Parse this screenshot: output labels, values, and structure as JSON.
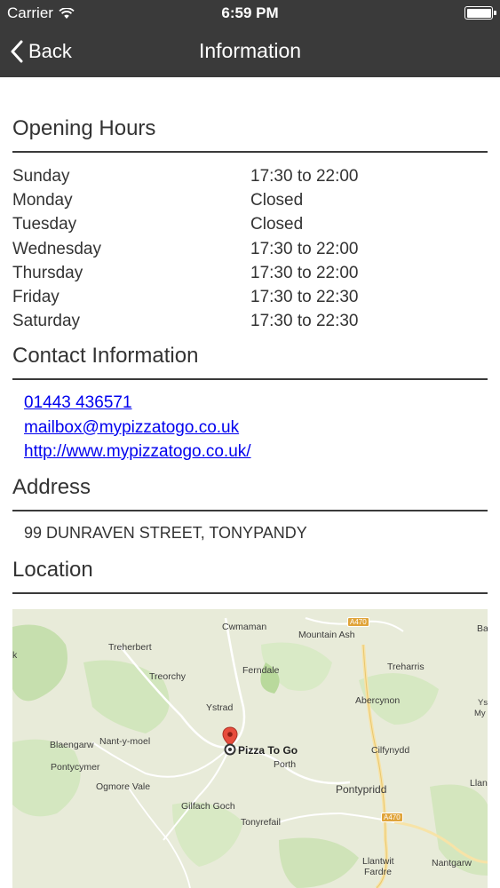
{
  "status_bar": {
    "carrier": "Carrier",
    "time": "6:59 PM",
    "battery_level": 1.0
  },
  "nav": {
    "back_label": "Back",
    "title": "Information"
  },
  "opening_hours": {
    "title": "Opening Hours",
    "rows": [
      {
        "day": "Sunday",
        "hours": "17:30 to 22:00"
      },
      {
        "day": "Monday",
        "hours": "Closed"
      },
      {
        "day": "Tuesday",
        "hours": "Closed"
      },
      {
        "day": "Wednesday",
        "hours": "17:30 to 22:00"
      },
      {
        "day": "Thursday",
        "hours": "17:30 to 22:00"
      },
      {
        "day": "Friday",
        "hours": "17:30 to 22:30"
      },
      {
        "day": "Saturday",
        "hours": "17:30 to 22:30"
      }
    ]
  },
  "contact": {
    "title": "Contact Information",
    "phone": "01443 436571",
    "email": "mailbox@mypizzatogo.co.uk",
    "website": "http://www.mypizzatogo.co.uk/"
  },
  "address": {
    "title": "Address",
    "value": "99 DUNRAVEN STREET, TONYPANDY"
  },
  "location": {
    "title": "Location",
    "pin_label": "Pizza To Go",
    "places": {
      "cwmaman": "Cwmaman",
      "mountain_ash": "Mountain Ash",
      "treherbert": "Treherbert",
      "ferndale": "Ferndale",
      "treharris": "Treharris",
      "treorchy": "Treorchy",
      "abercynon": "Abercynon",
      "ystrad": "Ystrad",
      "blaengarw": "Blaengarw",
      "nant_y_moel": "Nant-y-moel",
      "porth": "Porth",
      "cilfynydd": "Cilfynydd",
      "pontycymer": "Pontycymer",
      "ogmore_vale": "Ogmore Vale",
      "pontypridd": "Pontypridd",
      "gilfach_goch": "Gilfach Goch",
      "tonyrefail": "Tonyrefail",
      "llantwit_fardre_1": "Llantwit",
      "llantwit_fardre_2": "Fardre",
      "nantgarw": "Nantgarw",
      "edge_ba": "Ba",
      "edge_ys": "Ys",
      "edge_my": "My",
      "edge_llan": "Llan",
      "edge_k": "k"
    },
    "roads": {
      "a470_north": "A470",
      "a470_south": "A470"
    }
  }
}
